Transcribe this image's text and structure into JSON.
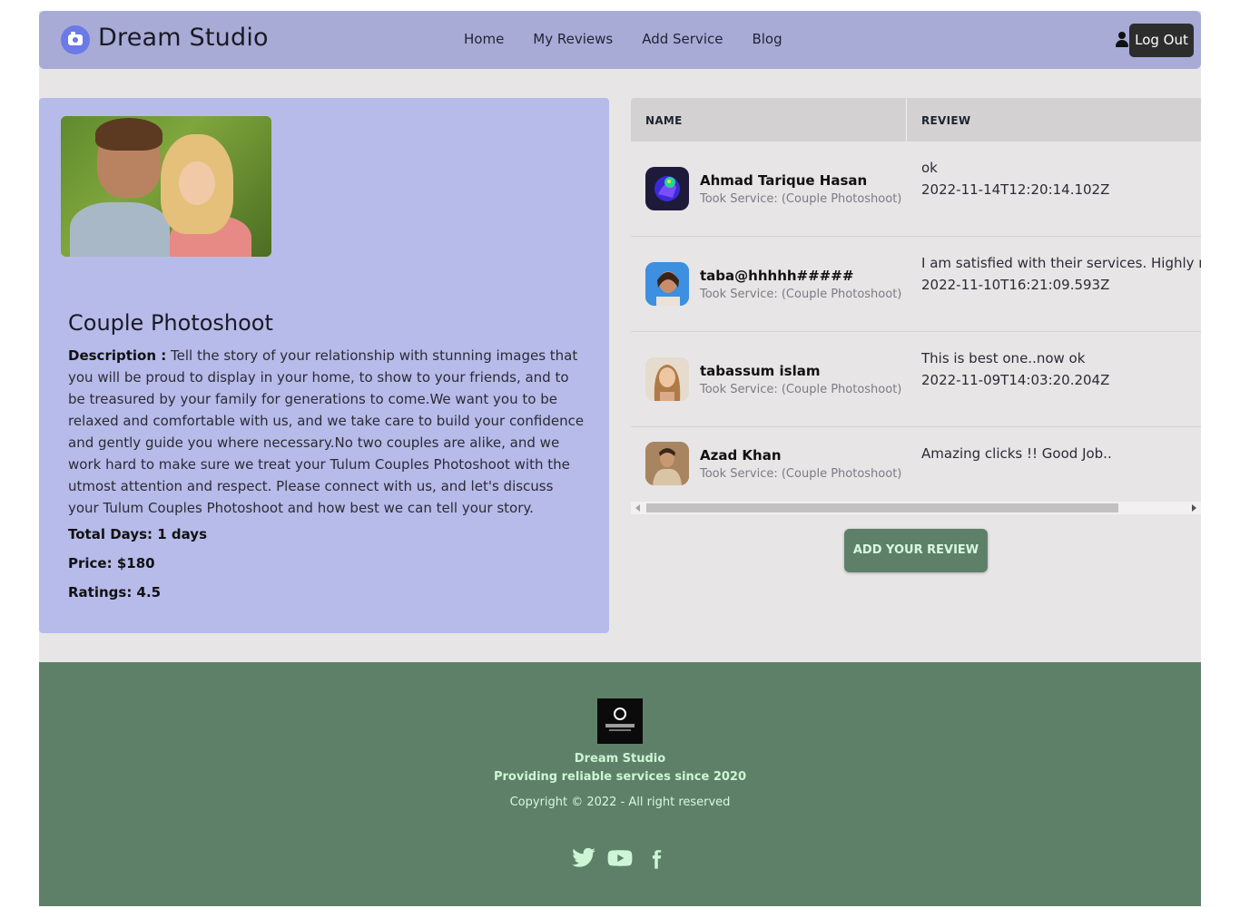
{
  "brand": {
    "name": "Dream Studio"
  },
  "nav": {
    "items": [
      "Home",
      "My Reviews",
      "Add Service",
      "Blog"
    ],
    "logout": "Log Out"
  },
  "service": {
    "title": "Couple Photoshoot",
    "description_label": "Description :",
    "description": "Tell the story of your relationship with stunning images that you will be proud to display in your home, to show to your friends, and to be treasured by your family for generations to come.We want you to be relaxed and comfortable with us, and we take care to build your confidence and gently guide you where necessary.No two couples are alike, and we work hard to make sure we treat your Tulum Couples Photoshoot with the utmost attention and respect. Please connect with us, and let's discuss your Tulum Couples Photoshoot and how best we can tell your story.",
    "total_days": "Total Days: 1 days",
    "price": "Price: $180",
    "ratings": "Ratings: 4.5"
  },
  "reviews": {
    "headers": [
      "NAME",
      "REVIEW"
    ],
    "rows": [
      {
        "name": "Ahmad Tarique Hasan",
        "service": "Took Service: (Couple Photoshoot)",
        "review": "ok",
        "date": "2022-11-14T12:20:14.102Z"
      },
      {
        "name": "taba@hhhhh#####",
        "service": "Took Service: (Couple Photoshoot)",
        "review": "I am satisfied with their services. Highly reco",
        "date": "2022-11-10T16:21:09.593Z"
      },
      {
        "name": "tabassum islam",
        "service": "Took Service: (Couple Photoshoot)",
        "review": "This is best one..now ok",
        "date": "2022-11-09T14:03:20.204Z"
      },
      {
        "name": "Azad Khan",
        "service": "Took Service: (Couple Photoshoot)",
        "review": "Amazing clicks !! Good Job..",
        "date": ""
      }
    ],
    "add_button": "ADD YOUR REVIEW"
  },
  "footer": {
    "name": "Dream Studio",
    "tagline": "Providing reliable services since 2020",
    "copyright": "Copyright © 2022 - All right reserved",
    "socials": [
      "twitter-icon",
      "youtube-icon",
      "facebook-icon"
    ]
  },
  "colors": {
    "navbar": "#a8abd6",
    "card": "#b7bbea",
    "page_bg": "#e7e5e6",
    "footer": "#5e8068",
    "footer_text": "#cdf5d6",
    "logout": "#2d2d2d"
  }
}
